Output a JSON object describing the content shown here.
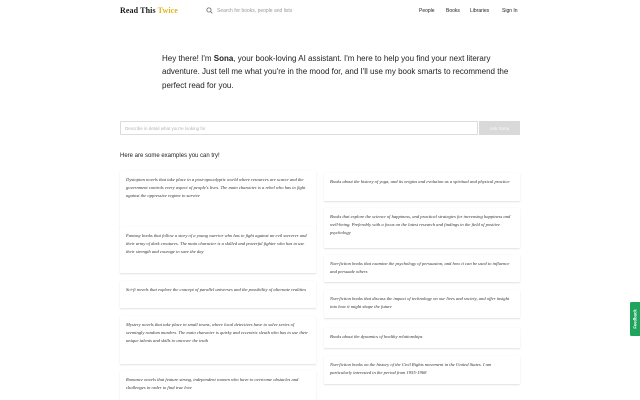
{
  "header": {
    "logo_main": "Read This ",
    "logo_accent": "Twice",
    "search_placeholder": "Search for books, people and lists",
    "nav": {
      "people": "People",
      "books": "Books",
      "libraries": "Libraries",
      "signin": "Sign In"
    }
  },
  "intro": {
    "prefix": "Hey there! I'm ",
    "name": "Sona",
    "suffix": ", your book-loving AI assistant. I'm here to help you find your next literary adventure. Just tell me what you're in the mood for, and I'll use my book smarts to recommend the perfect read for you."
  },
  "ask": {
    "placeholder": "Describe in detail what you're looking for",
    "button": "Ask Sona"
  },
  "examples_title": "Here are some examples you can try!",
  "examples_left": [
    "Dystopian novels that take place in a post-apocalyptic world where resources are scarce and the government controls every aspect of people's lives. The main character is a rebel who has to fight against the oppressive regime to survive",
    "Fantasy books that follow a story of a young warrior who has to fight against an evil sorcerer and their army of dark creatures. The main character is a skilled and powerful fighter who has to use their strength and courage to save the day",
    "Sci-fi novels that explore the concept of parallel universes and the possibility of alternate realities",
    "Mystery novels that take place in small towns, where local detectives have to solve series of seemingly random murders. The main character is quirky and eccentric sleuth who has to use their unique talents and skills to uncover the truth",
    "Romance novels that feature strong, independent women who have to overcome obstacles and challenges in order to find true love"
  ],
  "examples_right": [
    "Books about the history of yoga, and its origins and evolution as a spiritual and physical practice",
    "Books that explore the science of happiness, and practical strategies for increasing happiness and well-being. Preferably with a focus on the latest research and findings in the field of positive psychology",
    "Non-fiction books that examine the psychology of persuasion, and how it can be used to influence and persuade others",
    "Non-fiction books that discuss the impact of technology on our lives and society, and offer insight into how it might shape the future",
    "Books about the dynamics of healthy relationships",
    "Non-fiction books on the history of the Civil Rights movement in the United States. I am particularly interested in the period from 1955-1968"
  ],
  "feedback_label": "Feedback",
  "colors": {
    "logo_accent": "#e0b321",
    "feedback_green": "#1fa45e",
    "button_gray": "#d9d9d9"
  }
}
